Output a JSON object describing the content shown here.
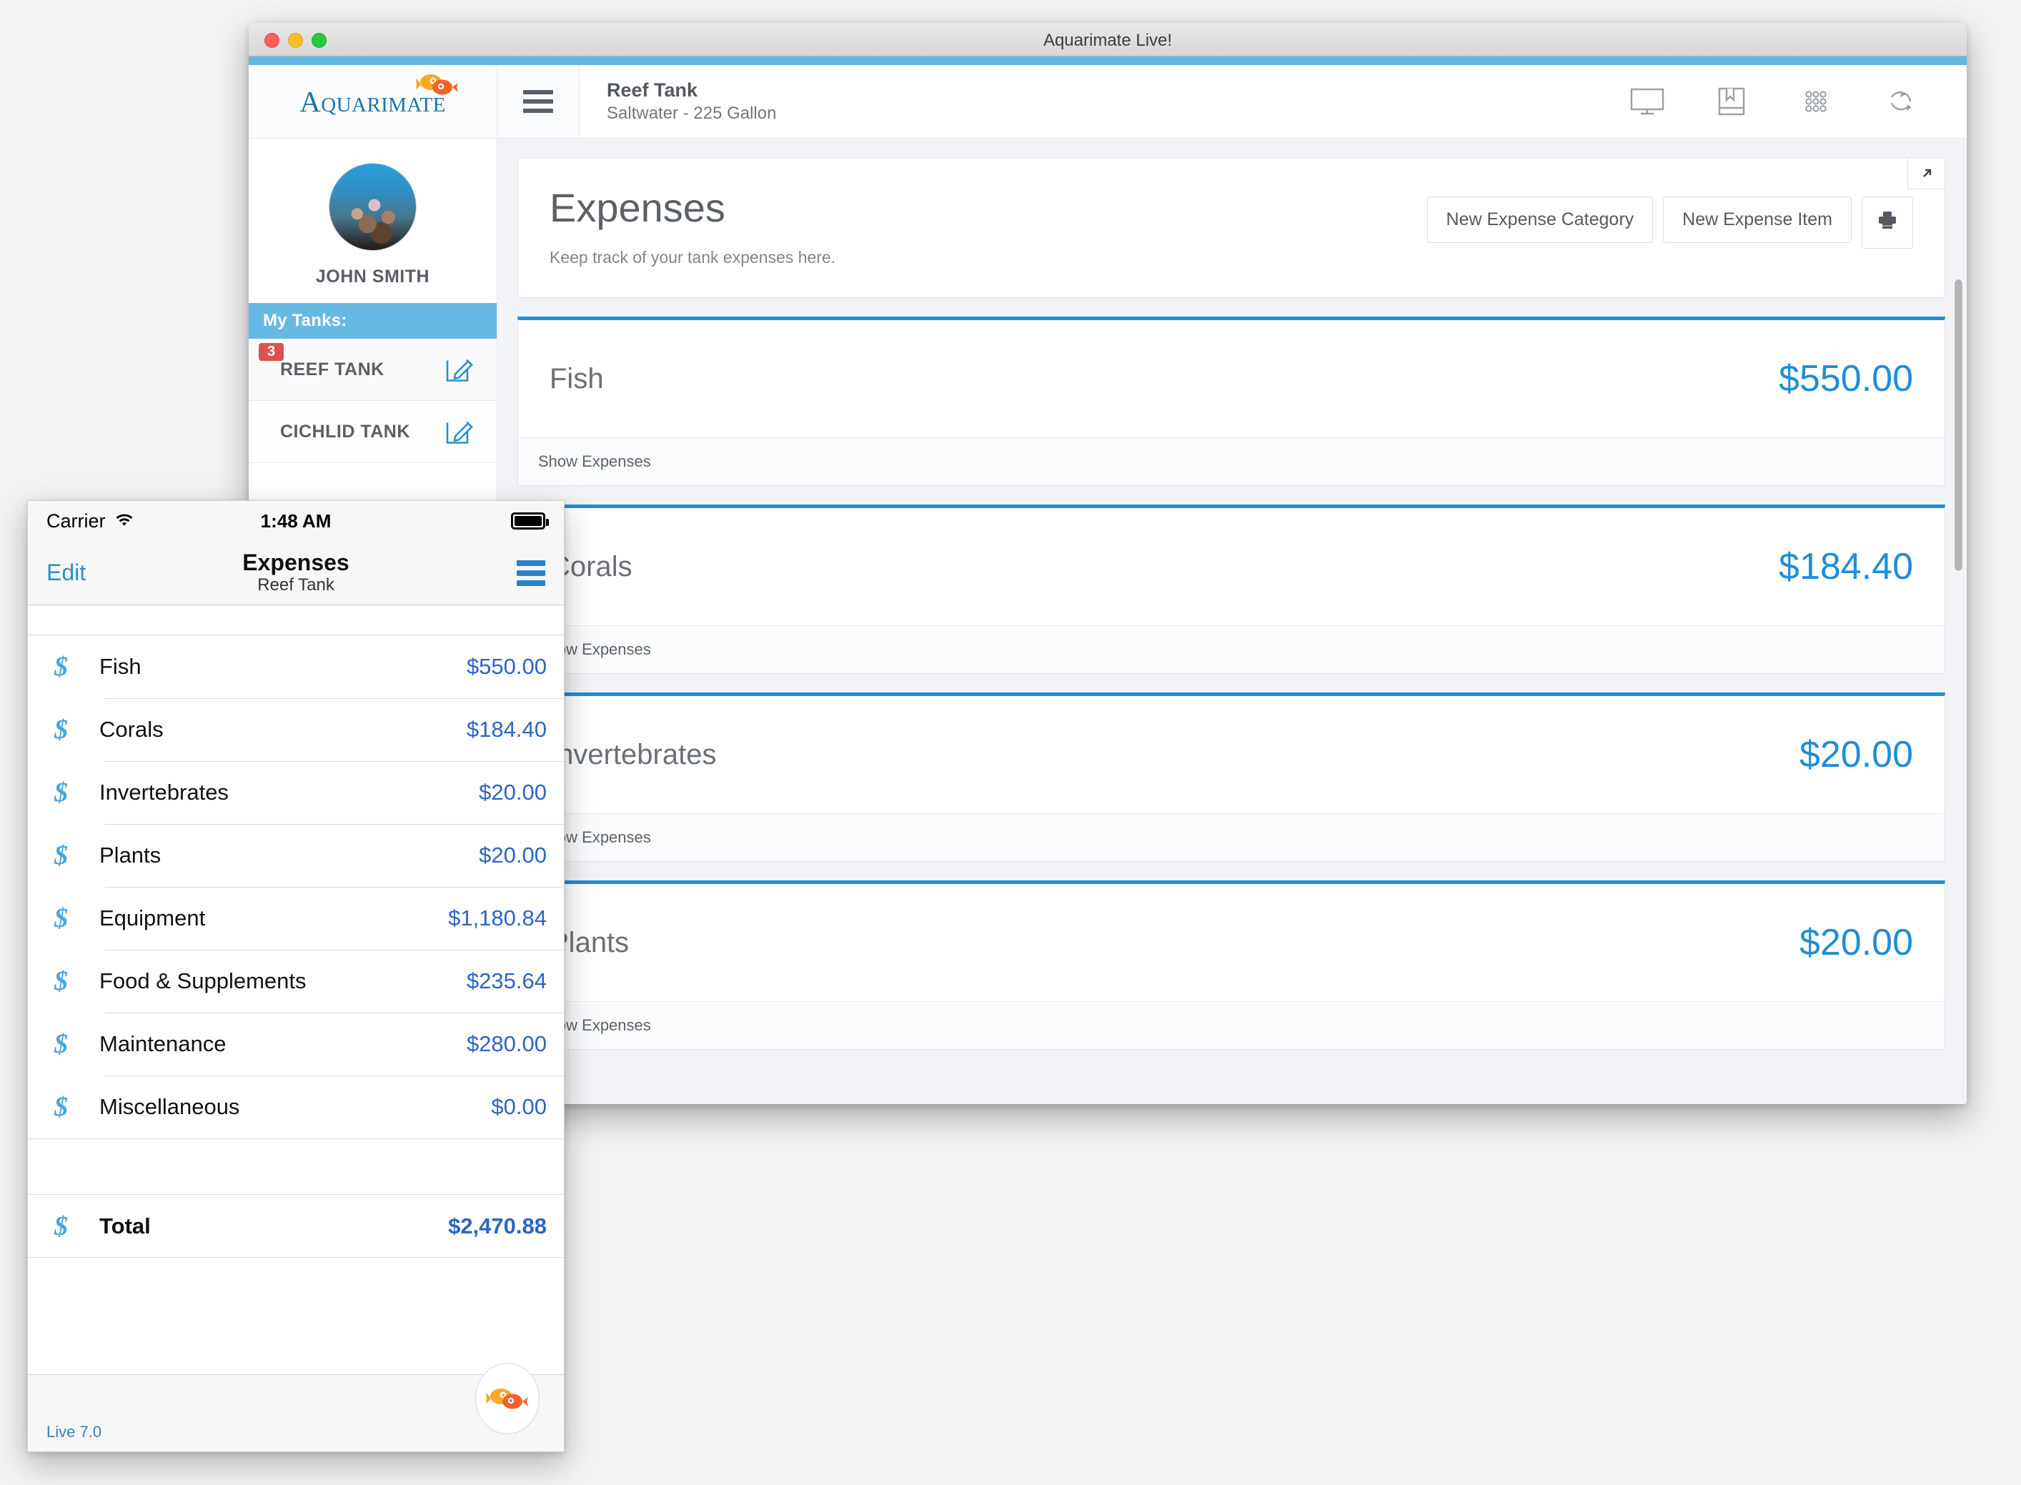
{
  "desktop": {
    "window_title": "Aquarimate Live!",
    "logo_text": "Aquarimate",
    "menu_icon": "hamburger-menu-icon",
    "tank": {
      "name": "Reef Tank",
      "subtitle": "Saltwater - 225 Gallon"
    },
    "toolbar_icons": [
      "monitor-icon",
      "book-icon",
      "grid-apps-icon",
      "refresh-icon"
    ],
    "sidebar": {
      "profile_name": "JOHN SMITH",
      "my_tanks_label": "My Tanks:",
      "tanks": [
        {
          "label": "REEF TANK",
          "badge": "3"
        },
        {
          "label": "CICHLID TANK",
          "badge": ""
        }
      ]
    },
    "page": {
      "title": "Expenses",
      "subtitle": "Keep track of your tank expenses here.",
      "new_category_button": "New Expense Category",
      "new_item_button": "New Expense Item",
      "print_icon": "printer-icon",
      "expand_icon": "expand-arrow-icon",
      "show_expenses_label": "Show Expenses"
    },
    "categories": [
      {
        "name": "Fish",
        "amount": "$550.00"
      },
      {
        "name": "Corals",
        "amount": "$184.40"
      },
      {
        "name": "Invertebrates",
        "amount": "$20.00"
      },
      {
        "name": "Plants",
        "amount": "$20.00"
      }
    ]
  },
  "phone": {
    "status": {
      "carrier": "Carrier",
      "wifi_icon": "wifi-icon",
      "time": "1:48 AM",
      "battery_icon": "battery-full-icon"
    },
    "nav": {
      "edit": "Edit",
      "title": "Expenses",
      "subtitle": "Reef Tank",
      "menu_icon": "hamburger-menu-icon"
    },
    "rows": [
      {
        "icon": "dollar-icon",
        "label": "Fish",
        "amount": "$550.00"
      },
      {
        "icon": "dollar-icon",
        "label": "Corals",
        "amount": "$184.40"
      },
      {
        "icon": "dollar-icon",
        "label": "Invertebrates",
        "amount": "$20.00"
      },
      {
        "icon": "dollar-icon",
        "label": "Plants",
        "amount": "$20.00"
      },
      {
        "icon": "dollar-icon",
        "label": "Equipment",
        "amount": "$1,180.84"
      },
      {
        "icon": "dollar-icon",
        "label": "Food & Supplements",
        "amount": "$235.64"
      },
      {
        "icon": "dollar-icon",
        "label": "Maintenance",
        "amount": "$280.00"
      },
      {
        "icon": "dollar-icon",
        "label": "Miscellaneous",
        "amount": "$0.00"
      }
    ],
    "total": {
      "icon": "dollar-icon",
      "label": "Total",
      "amount": "$2,470.88"
    },
    "footer": {
      "version": "Live 7.0",
      "fab_icon": "aquarimate-fish-logo-icon"
    }
  },
  "colors": {
    "accent_blue": "#1f8ed6",
    "sidebar_header_blue": "#66b9e3",
    "badge_red": "#d9534f",
    "phone_link_blue": "#2b8ed0",
    "phone_amount_blue": "#2d64c4"
  }
}
